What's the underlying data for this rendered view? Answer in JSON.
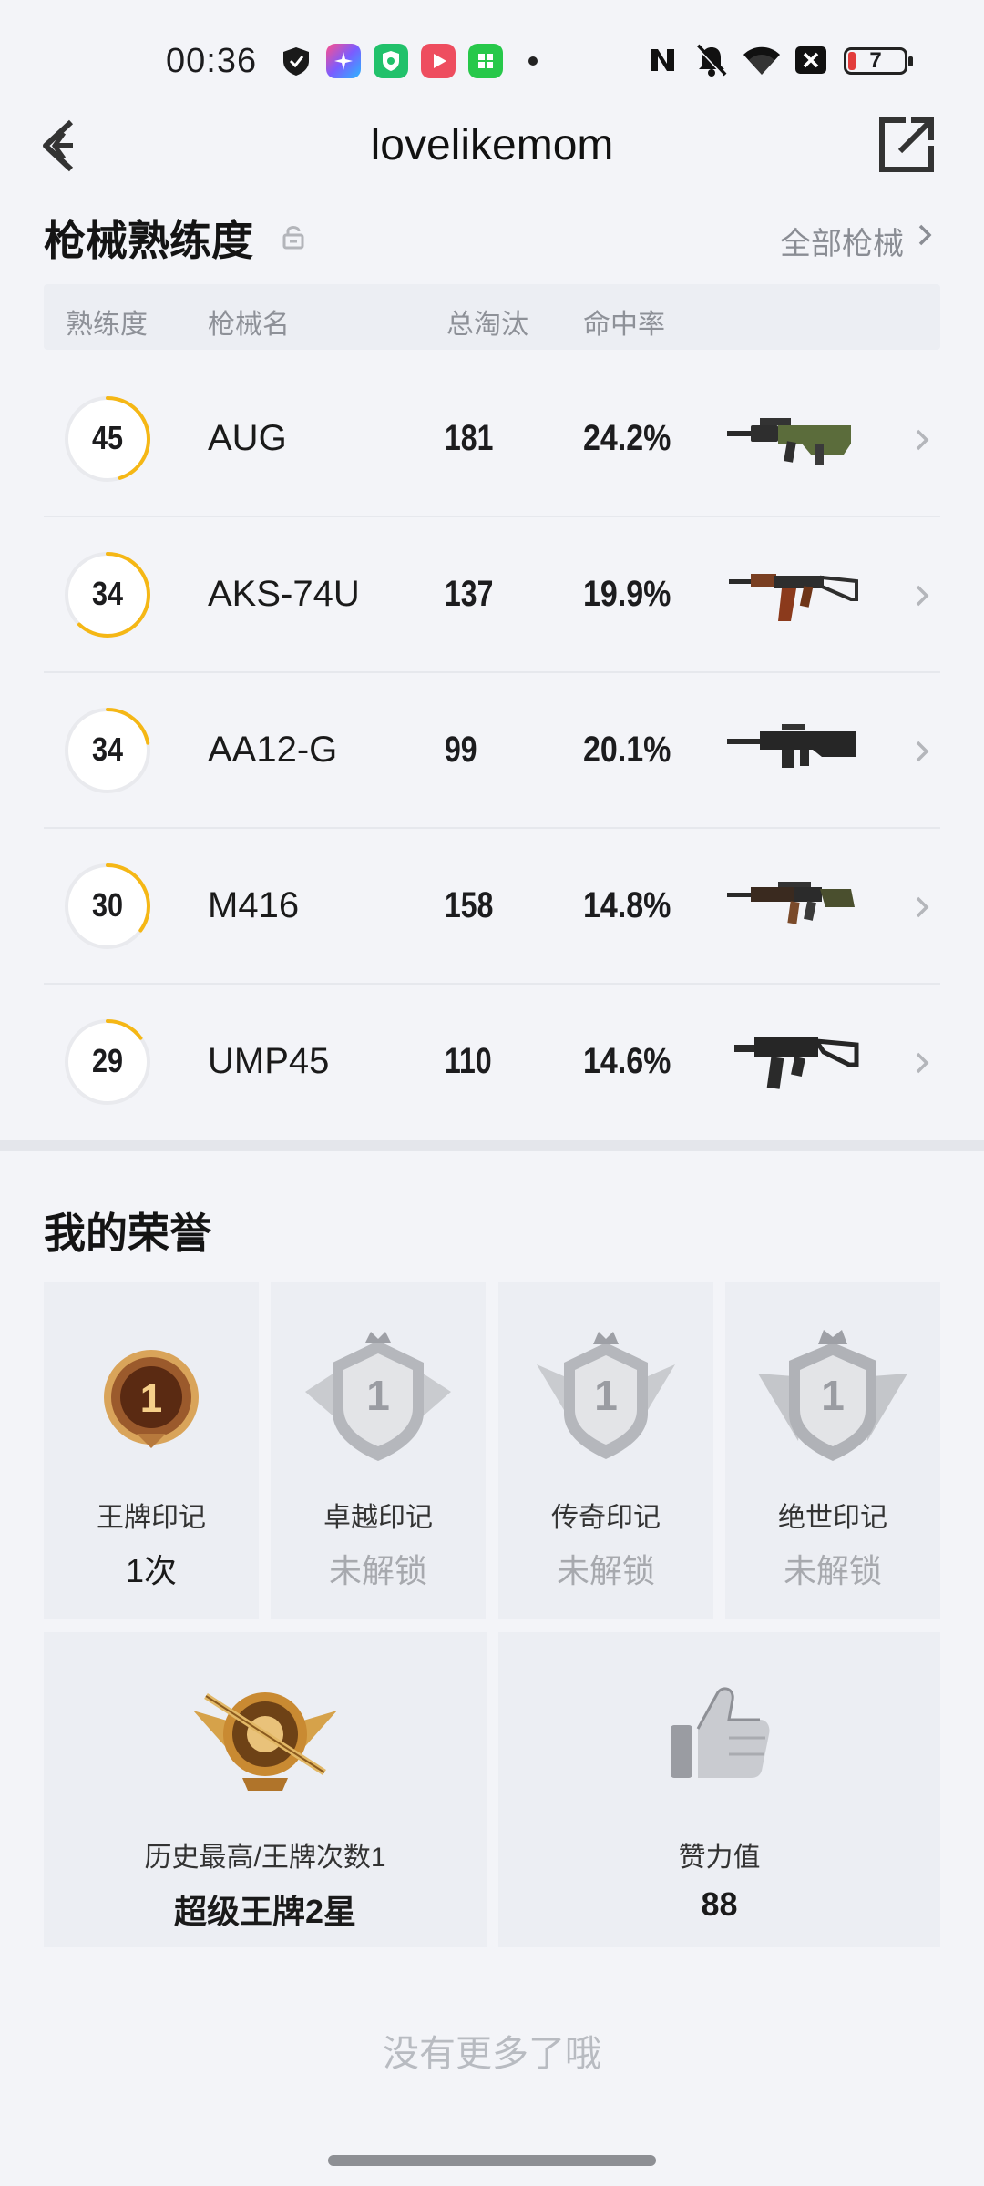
{
  "status_bar": {
    "time": "00:36",
    "battery_level": "7",
    "icons": [
      "shield-app-icon",
      "photos-app-icon",
      "security-app-icon",
      "video-app-icon",
      "appstore-app-icon",
      "nfc-icon",
      "mute-icon",
      "wifi-icon",
      "close-box-icon",
      "battery-icon"
    ]
  },
  "nav": {
    "title": "lovelikemom"
  },
  "weapons": {
    "section_title": "枪械熟练度",
    "see_all": "全部枪械",
    "headers": {
      "mastery": "熟练度",
      "name": "枪械名",
      "kills": "总淘汰",
      "hit_rate": "命中率"
    },
    "rows": [
      {
        "level": "45",
        "level_progress": 0.45,
        "name": "AUG",
        "kills": "181",
        "hit_rate": "24.2%",
        "icon": "aug-rifle-icon"
      },
      {
        "level": "34",
        "level_progress": 0.62,
        "name": "AKS-74U",
        "kills": "137",
        "hit_rate": "19.9%",
        "icon": "aks74u-rifle-icon"
      },
      {
        "level": "34",
        "level_progress": 0.22,
        "name": "AA12-G",
        "kills": "99",
        "hit_rate": "20.1%",
        "icon": "aa12-shotgun-icon"
      },
      {
        "level": "30",
        "level_progress": 0.35,
        "name": "M416",
        "kills": "158",
        "hit_rate": "14.8%",
        "icon": "m416-rifle-icon"
      },
      {
        "level": "29",
        "level_progress": 0.15,
        "name": "UMP45",
        "kills": "110",
        "hit_rate": "14.6%",
        "icon": "ump45-smg-icon"
      }
    ]
  },
  "honors": {
    "section_title": "我的荣誉",
    "badges": [
      {
        "label": "王牌印记",
        "value": "1次",
        "unlocked": true,
        "icon": "ace-mark-medal-icon",
        "medal_number": "1"
      },
      {
        "label": "卓越印记",
        "value": "未解锁",
        "unlocked": false,
        "icon": "excellence-mark-medal-icon",
        "medal_number": "1"
      },
      {
        "label": "传奇印记",
        "value": "未解锁",
        "unlocked": false,
        "icon": "legend-mark-medal-icon",
        "medal_number": "1"
      },
      {
        "label": "绝世印记",
        "value": "未解锁",
        "unlocked": false,
        "icon": "peerless-mark-medal-icon",
        "medal_number": "1"
      }
    ],
    "highest": {
      "label": "历史最高/王牌次数1",
      "value": "超级王牌2星",
      "icon": "super-ace-emblem-icon"
    },
    "likes": {
      "label": "赞力值",
      "value": "88",
      "icon": "thumbs-up-icon"
    }
  },
  "footer": {
    "text": "没有更多了哦"
  },
  "colors": {
    "accent": "#f5b715",
    "ring_track": "#e9eaee",
    "background": "#f3f4f8",
    "card": "#eceef3"
  }
}
